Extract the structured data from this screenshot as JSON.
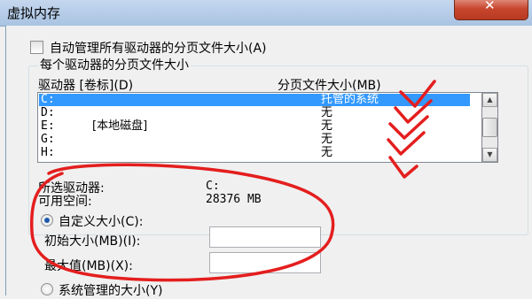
{
  "window": {
    "title": "虚拟内存",
    "close_label": "✕"
  },
  "auto_manage": {
    "label": "自动管理所有驱动器的分页文件大小(A)",
    "checked": false
  },
  "paging_group": {
    "title": "每个驱动器的分页文件大小",
    "col_drive": "驱动器 [卷标](D)",
    "col_size": "分页文件大小(MB)",
    "rows": [
      {
        "drive": "C:",
        "label": "",
        "size": "托管的系统",
        "selected": true
      },
      {
        "drive": "D:",
        "label": "",
        "size": "无",
        "selected": false
      },
      {
        "drive": "E:",
        "label": "[本地磁盘]",
        "size": "无",
        "selected": false
      },
      {
        "drive": "G:",
        "label": "",
        "size": "无",
        "selected": false
      },
      {
        "drive": "H:",
        "label": "",
        "size": "无",
        "selected": false
      }
    ]
  },
  "selected_drive": {
    "label": "所选驱动器:",
    "value": "C:"
  },
  "available_space": {
    "label": "可用空间:",
    "value": "28376 MB"
  },
  "custom_size": {
    "label": "自定义大小(C):",
    "initial_label": "初始大小(MB)(I):",
    "initial_value": "",
    "max_label": "最大值(MB)(X):",
    "max_value": ""
  },
  "system_managed": {
    "label": "系统管理的大小(Y)"
  },
  "colors": {
    "selection": "#3399ff",
    "annotation": "#e41e1e",
    "radio_dot": "#1d5aab"
  }
}
